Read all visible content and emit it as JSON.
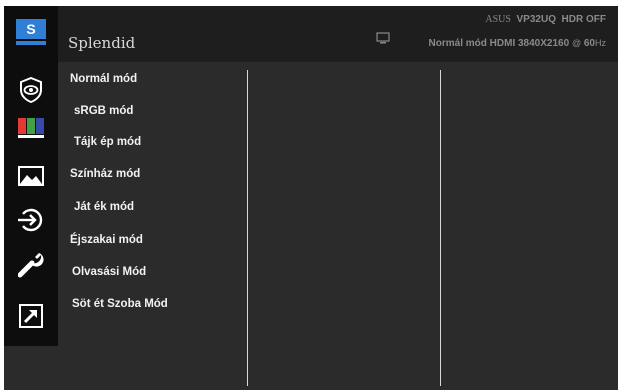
{
  "header": {
    "title": "Splendid",
    "model_brand": "ASUS",
    "model_name": "VP32UQ",
    "hdr_status": "HDR OFF",
    "status_mode": "Normál mód HDMI 3840X2160",
    "status_at": "@",
    "status_rate": "60",
    "status_unit": "Hz",
    "monitor_icon": "monitor-icon"
  },
  "sidebar": {
    "items": [
      {
        "icon": "splendid-s-icon",
        "label": "S"
      },
      {
        "icon": "eye-care-icon"
      },
      {
        "icon": "color-bars-icon"
      },
      {
        "icon": "image-icon"
      },
      {
        "icon": "input-select-icon"
      },
      {
        "icon": "wrench-icon"
      },
      {
        "icon": "shortcut-arrow-icon"
      }
    ]
  },
  "menu": {
    "items": [
      {
        "label": "Normál mód"
      },
      {
        "label": "sRGB mód"
      },
      {
        "label": "Tájk  ép mód"
      },
      {
        "label": "Színház mód"
      },
      {
        "label": "Ját  ék mód"
      },
      {
        "label": "Éjszakai mód"
      },
      {
        "label": "Olvasási Mód"
      },
      {
        "label": "Söt  ét Szoba Mód"
      }
    ]
  },
  "colors": {
    "accent_blue": "#2f7fd6",
    "background": "#2b2b2b",
    "sidebar": "#0d0d0d",
    "header": "#1e1e1e"
  }
}
